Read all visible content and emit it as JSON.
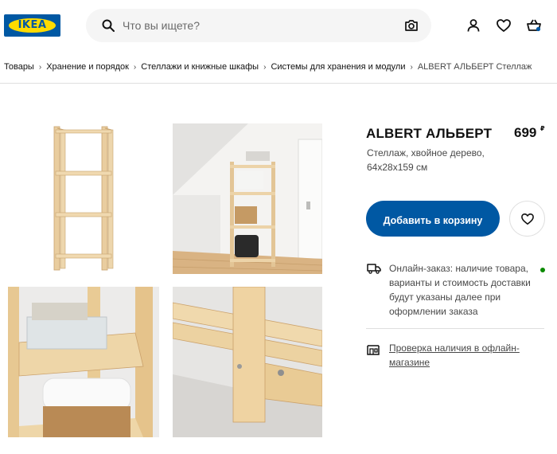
{
  "header": {
    "logo_text": "IKEA",
    "search_placeholder": "Что вы ищете?"
  },
  "breadcrumb": [
    "Товары",
    "Хранение и порядок",
    "Стеллажи и книжные шкафы",
    "Системы для хранения и модули",
    "ALBERT АЛЬБЕРТ Стеллаж"
  ],
  "product": {
    "title": "ALBERT АЛЬБЕРТ",
    "price": "699",
    "currency": "₽",
    "description": "Стеллаж, хвойное дерево, 64x28x159 см",
    "add_to_cart": "Добавить в корзину",
    "delivery_info": "Онлайн-заказ: наличие товара, варианты и стоимость доставки будут указаны далее при оформлении заказа",
    "store_check": "Проверка наличия в офлайн-магазине"
  },
  "colors": {
    "brand_blue": "#0058a3",
    "brand_yellow": "#ffdb00",
    "status_green": "#0a8a00"
  }
}
